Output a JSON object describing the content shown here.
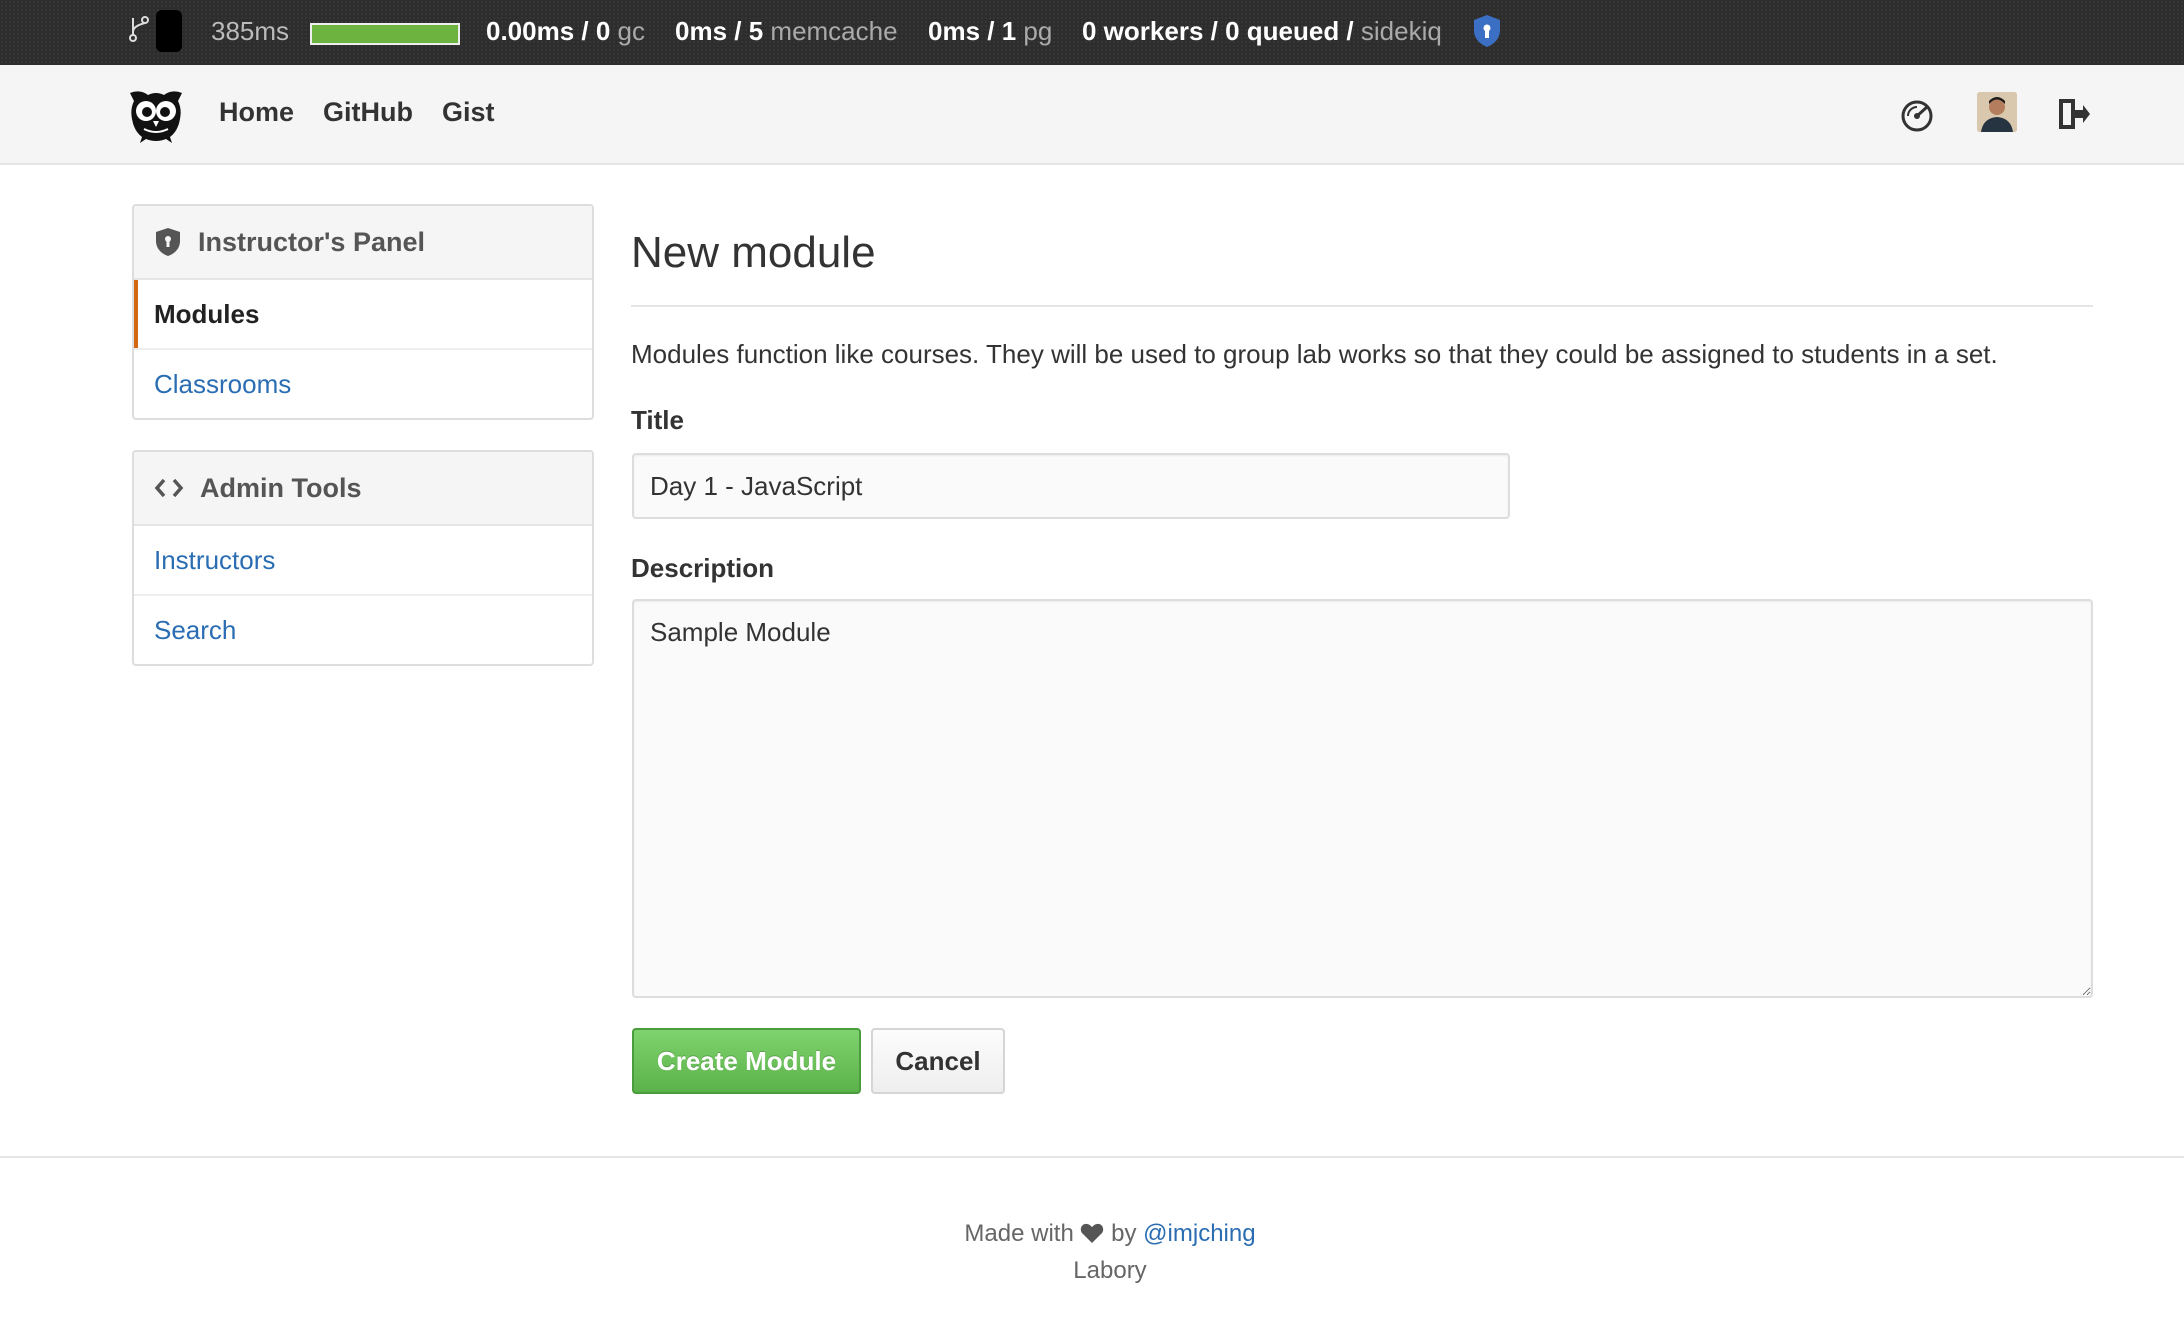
{
  "stats_bar": {
    "request_time": "385ms",
    "gc": {
      "value": "0.00ms / 0",
      "label": "gc"
    },
    "memcache": {
      "value": "0ms / 5",
      "label": "memcache"
    },
    "pg": {
      "value": "0ms / 1",
      "label": "pg"
    },
    "sidekiq": {
      "value": "0 workers / 0 queued /",
      "label": "sidekiq"
    },
    "progress_fraction": 1.0
  },
  "navbar": {
    "links": [
      "Home",
      "GitHub",
      "Gist"
    ],
    "icons": [
      "owl-logo-icon",
      "dashboard-icon",
      "avatar",
      "sign-out-icon"
    ]
  },
  "sidebar": {
    "instructor_panel": {
      "title": "Instructor's Panel",
      "items": [
        "Modules",
        "Classrooms"
      ],
      "active": "Modules"
    },
    "admin_tools": {
      "title": "Admin Tools",
      "items": [
        "Instructors",
        "Search"
      ]
    }
  },
  "main": {
    "title": "New module",
    "intro": "Modules function like courses. They will be used to group lab works so that they could be assigned to students in a set.",
    "title_label": "Title",
    "title_value": "Day 1 - JavaScript",
    "description_label": "Description",
    "description_value": "Sample Module",
    "create_button": "Create Module",
    "cancel_button": "Cancel"
  },
  "footer": {
    "made_with": "Made with",
    "by": "by",
    "author_link": "@imjching",
    "site_name": "Labory"
  },
  "colors": {
    "accent_link": "#2a6db3",
    "active_marker": "#d26911",
    "create_button": "#5bb14a",
    "progress": "#6cb33f"
  }
}
